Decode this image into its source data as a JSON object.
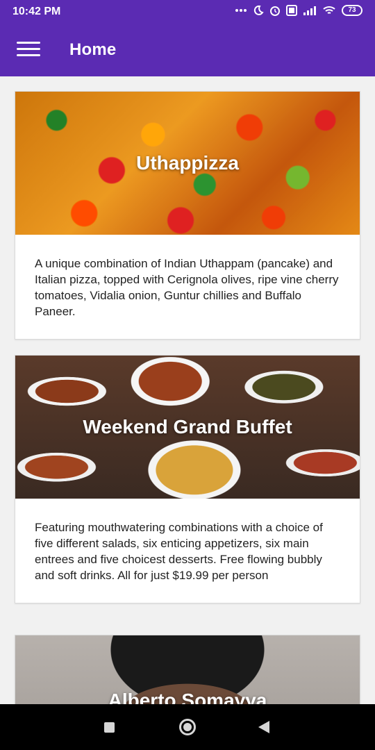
{
  "status_bar": {
    "time": "10:42 PM",
    "battery": "73",
    "icons": [
      "more-icon",
      "moon-icon",
      "alarm-icon",
      "data-icon",
      "signal-icon",
      "wifi-icon",
      "battery-icon"
    ]
  },
  "app_bar": {
    "title": "Home",
    "color": "#5b2bb3"
  },
  "cards": [
    {
      "title": "Uthappizza",
      "description": "A unique combination of Indian Uthappam (pancake) and Italian pizza, topped with Cerignola olives, ripe vine cherry tomatoes, Vidalia onion, Guntur chillies and Buffalo Paneer."
    },
    {
      "title": "Weekend Grand Buffet",
      "description": "Featuring mouthwatering combinations with a choice of five different salads, six enticing appetizers, six main entrees and five choicest desserts. Free flowing bubbly and soft drinks. All for just $19.99 per person"
    },
    {
      "title": "Alberto Somayya",
      "description": ""
    }
  ],
  "nav_bar": {
    "buttons": [
      "recents-button",
      "home-button",
      "back-button"
    ]
  }
}
